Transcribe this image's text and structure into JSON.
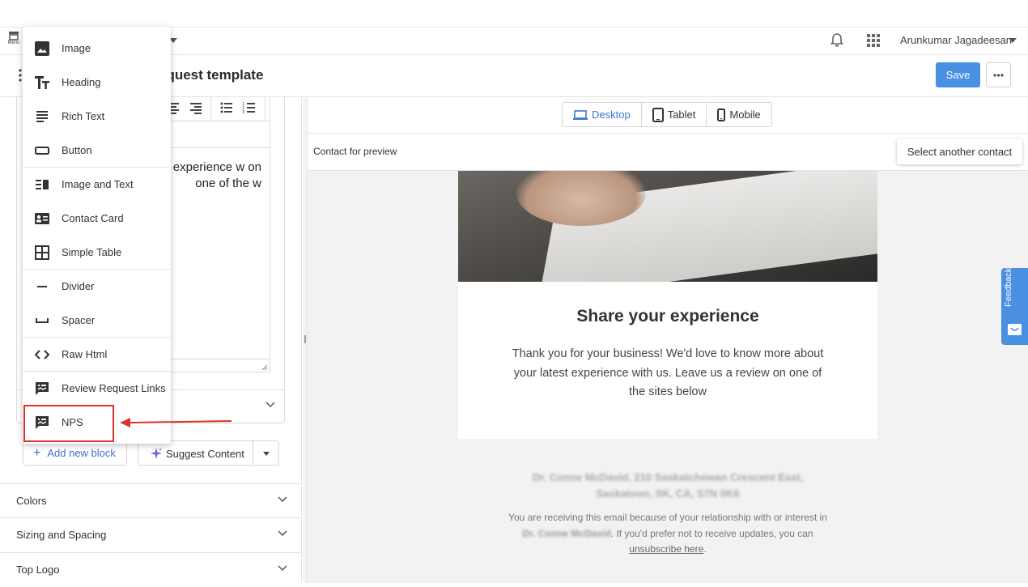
{
  "topbar": {
    "menu_label": "Menu",
    "user_name": "Arunkumar Jagadeesan"
  },
  "titlebar": {
    "title": "equest template",
    "save_label": "Save"
  },
  "editor": {
    "text": "ess! We'd love to atest experience w on one of the w"
  },
  "dropdown": {
    "items": [
      {
        "label": "Image",
        "icon": "image-icon"
      },
      {
        "label": "Heading",
        "icon": "heading-icon"
      },
      {
        "label": "Rich Text",
        "icon": "rich-text-icon"
      },
      {
        "label": "Button",
        "icon": "button-icon"
      },
      {
        "label": "Image and Text",
        "icon": "image-and-text-icon"
      },
      {
        "label": "Contact Card",
        "icon": "contact-card-icon"
      },
      {
        "label": "Simple Table",
        "icon": "table-icon"
      },
      {
        "label": "Divider",
        "icon": "divider-icon"
      },
      {
        "label": "Spacer",
        "icon": "spacer-icon"
      },
      {
        "label": "Raw Html",
        "icon": "code-icon"
      },
      {
        "label": "Review Request Links",
        "icon": "review-icon"
      },
      {
        "label": "NPS",
        "icon": "nps-icon"
      }
    ]
  },
  "left_actions": {
    "add_block_label": "Add new block",
    "suggest_label": "Suggest Content"
  },
  "sections": [
    {
      "label": "Colors"
    },
    {
      "label": "Sizing and Spacing"
    },
    {
      "label": "Top Logo"
    }
  ],
  "devices": [
    {
      "label": "Desktop",
      "active": true
    },
    {
      "label": "Tablet",
      "active": false
    },
    {
      "label": "Mobile",
      "active": false
    }
  ],
  "preview": {
    "contact_label": "Contact for preview",
    "select_contact_label": "Select another contact"
  },
  "email": {
    "heading": "Share your experience",
    "body": "Thank you for your business! We'd love to know more about your latest experience with us. Leave us a review on one of the sites below",
    "footer_address_line1": "Dr. Conne McDavid, 210 Saskatchewan Crescent East,",
    "footer_address_line2": "Saskatoon, SK, CA, S7N 0K6",
    "footer_prefix": "You are receiving this email because of your relationship with or interest in",
    "footer_blur_name": "Dr. Conne McDavid",
    "footer_suffix": ". If you'd prefer not to receive updates, you can",
    "unsubscribe": "unsubscribe here",
    "period": "."
  },
  "feedback_label": "Feedback",
  "colors": {
    "accent": "#4a90e2",
    "highlight": "#d9342b"
  }
}
